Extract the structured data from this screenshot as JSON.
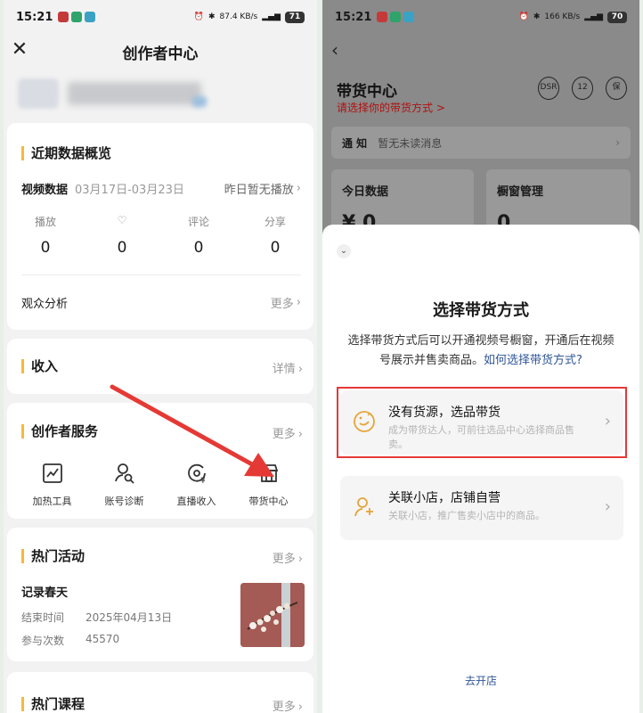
{
  "status_bar": {
    "time": "15:21",
    "left_net": "87.4 KB/s",
    "right_net": "166 KB/s",
    "left_battery": "71",
    "right_battery": "70"
  },
  "left": {
    "title": "创作者中心",
    "recent": {
      "title": "近期数据概览",
      "video_label": "视频数据",
      "date_range": "03月17日-03月23日",
      "status_link": "昨日暂无播放",
      "stats": [
        {
          "label": "播放",
          "value": "0"
        },
        {
          "label": "♡",
          "value": "0"
        },
        {
          "label": "评论",
          "value": "0"
        },
        {
          "label": "分享",
          "value": "0"
        }
      ],
      "audience_label": "观众分析",
      "more": "更多"
    },
    "income": {
      "title": "收入",
      "detail": "详情"
    },
    "services": {
      "title": "创作者服务",
      "more": "更多",
      "items": [
        {
          "label": "加热工具",
          "icon": "trend-chart-icon"
        },
        {
          "label": "账号诊断",
          "icon": "user-search-icon"
        },
        {
          "label": "直播收入",
          "icon": "live-income-icon"
        },
        {
          "label": "带货中心",
          "icon": "store-icon"
        }
      ]
    },
    "activities": {
      "title": "热门活动",
      "more": "更多",
      "event_name": "记录春天",
      "end_label": "结束时间",
      "end_value": "2025年04月13日",
      "count_label": "参与次数",
      "count_value": "45570"
    },
    "courses": {
      "title": "热门课程",
      "more": "更多"
    }
  },
  "right": {
    "page_title": "带货中心",
    "page_subtitle": "请选择你的带货方式 >",
    "header_icons": [
      "DSR",
      "12",
      "保"
    ],
    "notice_label": "通 知",
    "notice_text": "暂无未读消息",
    "today_label": "今日数据",
    "today_value": "¥ 0",
    "window_label": "橱窗管理",
    "window_value": "0",
    "sheet": {
      "title": "选择带货方式",
      "desc": "选择带货方式后可以开通视频号橱窗，开通后在视频号展示并售卖商品。",
      "desc_link": "如何选择带货方式?",
      "options": [
        {
          "title": "没有货源，选品带货",
          "desc": "成为带货达人，可前往选品中心选择商品售卖。"
        },
        {
          "title": "关联小店，店铺自营",
          "desc": "关联小店，推广售卖小店中的商品。"
        }
      ],
      "footer_link": "去开店"
    }
  },
  "colors": {
    "accent_bar": "#f6b83b",
    "highlight": "#e53935",
    "link": "#2f5597",
    "warning": "#b01010"
  }
}
